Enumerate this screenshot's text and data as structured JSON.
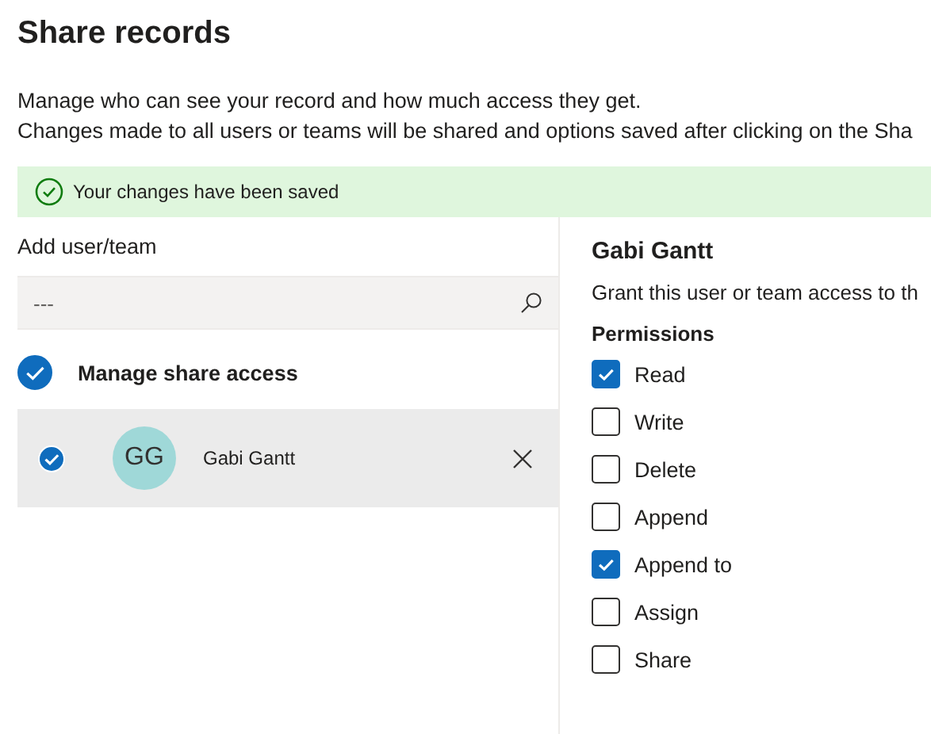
{
  "title": "Share records",
  "description": [
    "Manage who can see your record and how much access they get.",
    "Changes made to all users or teams will be shared and options saved after clicking on the Sha"
  ],
  "banner": {
    "text": "Your changes have been saved"
  },
  "add": {
    "label": "Add user/team",
    "search": {
      "placeholder": "---"
    }
  },
  "manage": {
    "label": "Manage share access",
    "checked": true
  },
  "users": [
    {
      "initials": "GG",
      "name": "Gabi Gantt",
      "selected": true,
      "checked": true
    }
  ],
  "detail": {
    "name": "Gabi Gantt",
    "hint": "Grant this user or team access to th",
    "permissions_label": "Permissions",
    "permissions": [
      {
        "label": "Read",
        "checked": true
      },
      {
        "label": "Write",
        "checked": false
      },
      {
        "label": "Delete",
        "checked": false
      },
      {
        "label": "Append",
        "checked": false
      },
      {
        "label": "Append to",
        "checked": true
      },
      {
        "label": "Assign",
        "checked": false
      },
      {
        "label": "Share",
        "checked": false
      }
    ]
  }
}
